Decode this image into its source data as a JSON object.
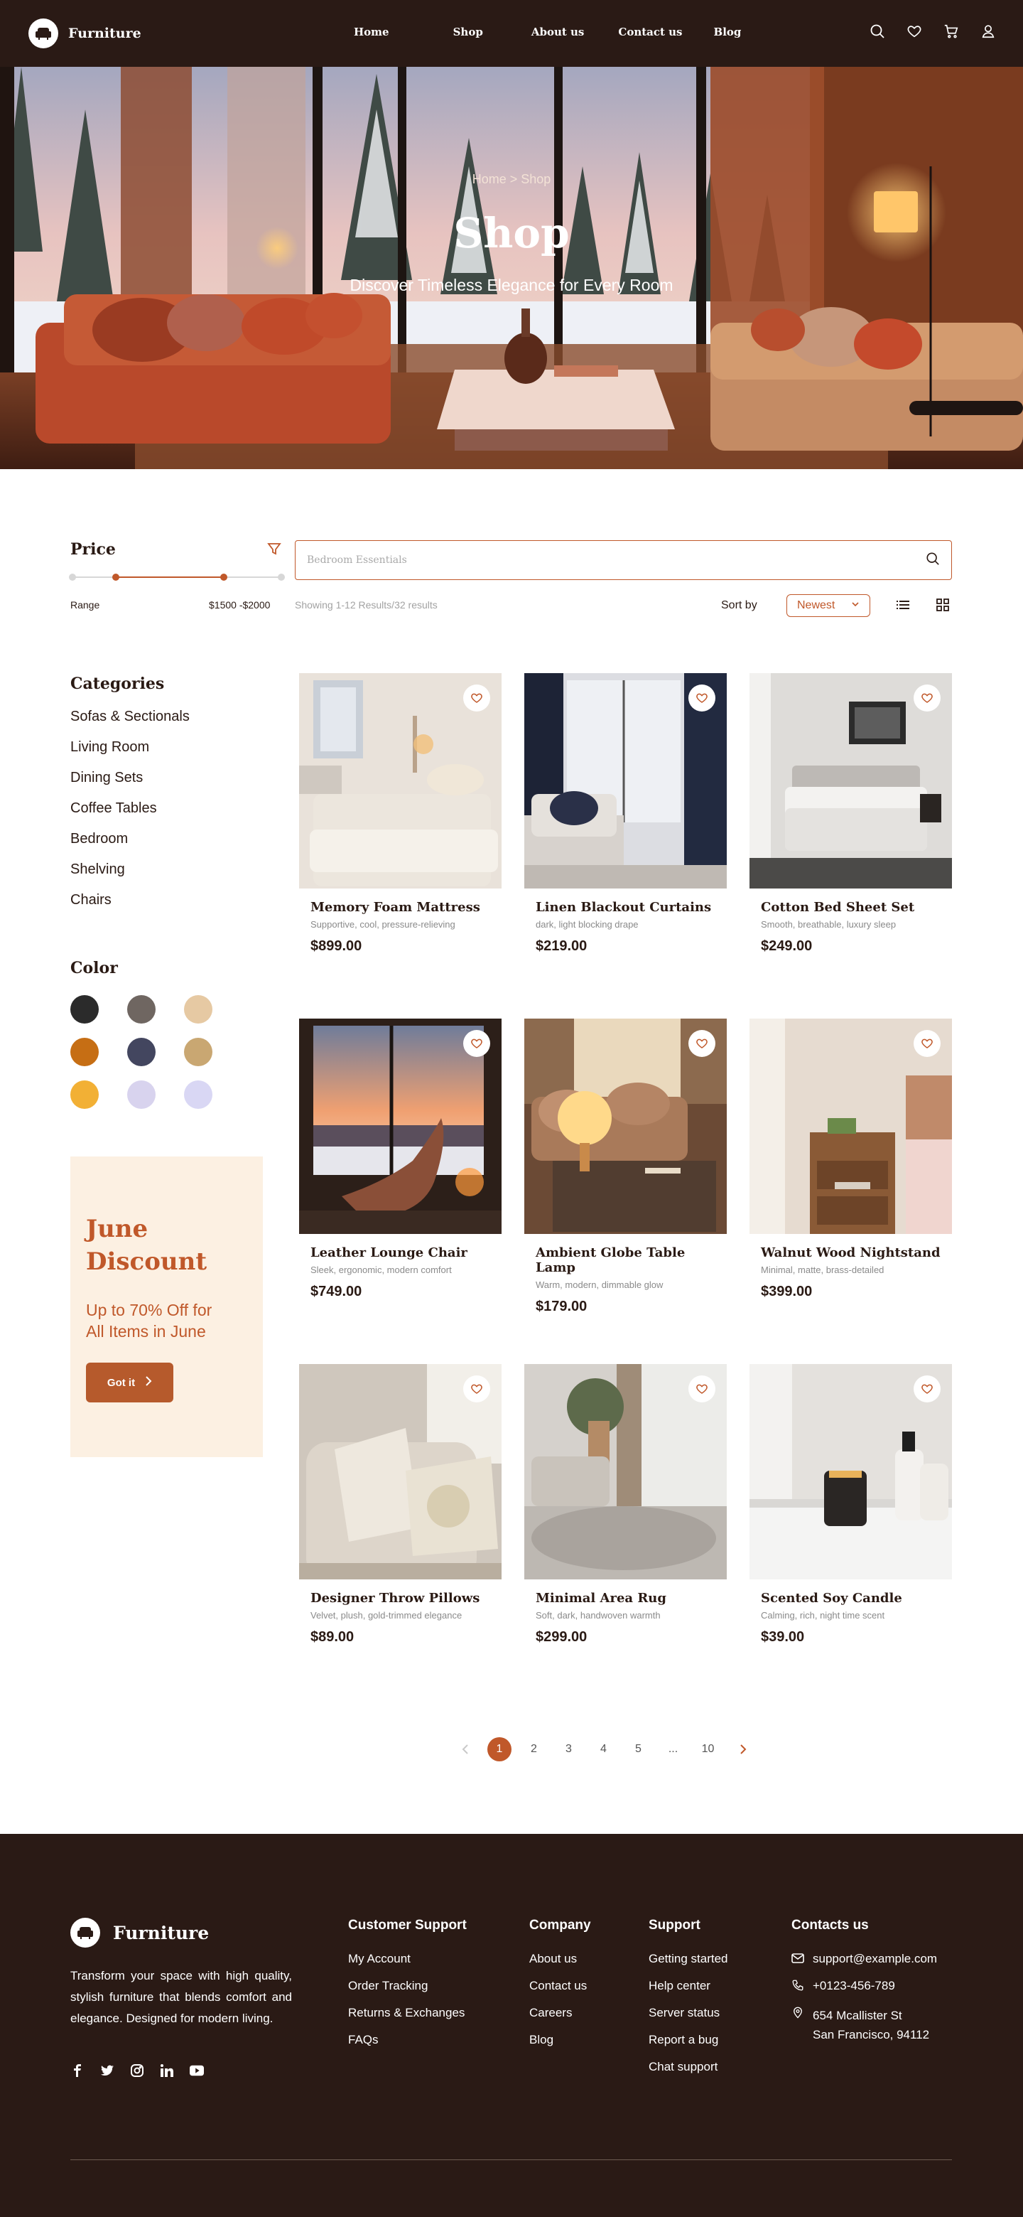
{
  "nav": {
    "brand": "Furniture",
    "links": [
      "Home",
      "Shop",
      "About us",
      "Contact us",
      "Blog"
    ]
  },
  "hero": {
    "breadcrumb": "Home > Shop",
    "title": "Shop",
    "subtitle": "Discover Timeless Elegance for Every Room"
  },
  "filters": {
    "price_title": "Price",
    "range_label": "Range",
    "range_value": "$1500 -$2000",
    "search_placeholder": "Bedroom Essentials",
    "showing": "Showing 1-12 Results/32 results",
    "sort_label": "Sort by",
    "sort_value": "Newest"
  },
  "sidebar": {
    "categories_title": "Categories",
    "categories": [
      "Sofas & Sectionals",
      "Living Room",
      "Dining Sets",
      "Coffee Tables",
      "Bedroom",
      "Shelving",
      "Chairs"
    ],
    "color_title": "Color",
    "colors": [
      "#2b2b2b",
      "#6f6661",
      "#e6c9a3",
      "#c66e14",
      "#43465f",
      "#c9a772",
      "#f2b035",
      "#d8d3ee",
      "#d9d7f4"
    ]
  },
  "promo": {
    "title": "June\nDiscount",
    "subtitle": "Up to 70% Off for\nAll Items in June",
    "button": "Got it"
  },
  "products": [
    {
      "name": "Memory Foam Mattress",
      "desc": "Supportive, cool, pressure-relieving",
      "price": "$899.00"
    },
    {
      "name": "Linen Blackout Curtains",
      "desc": "dark, light blocking drape",
      "price": "$219.00"
    },
    {
      "name": "Cotton Bed Sheet Set",
      "desc": "Smooth, breathable, luxury sleep",
      "price": "$249.00"
    },
    {
      "name": "Leather Lounge Chair",
      "desc": "Sleek, ergonomic, modern comfort",
      "price": "$749.00"
    },
    {
      "name": "Ambient Globe Table Lamp",
      "desc": "Warm, modern, dimmable glow",
      "price": "$179.00"
    },
    {
      "name": "Walnut Wood Nightstand",
      "desc": "Minimal, matte, brass-detailed",
      "price": "$399.00"
    },
    {
      "name": "Designer Throw Pillows",
      "desc": "Velvet, plush, gold-trimmed elegance",
      "price": "$89.00"
    },
    {
      "name": "Minimal Area Rug",
      "desc": "Soft, dark, handwoven warmth",
      "price": "$299.00"
    },
    {
      "name": "Scented Soy Candle",
      "desc": "Calming, rich, night time scent",
      "price": "$39.00"
    }
  ],
  "pagination": {
    "pages": [
      "1",
      "2",
      "3",
      "4",
      "5",
      "...",
      "10"
    ],
    "current": "1"
  },
  "footer": {
    "brand": "Furniture",
    "about": "Transform your space with high quality, stylish furniture that blends comfort and elegance. Designed for modern living.",
    "customer_support": {
      "title": "Customer Support",
      "links": [
        "My Account",
        "Order Tracking",
        "Returns & Exchanges",
        "FAQs"
      ]
    },
    "company": {
      "title": "Company",
      "links": [
        "About us",
        "Contact us",
        "Careers",
        "Blog"
      ]
    },
    "support": {
      "title": "Support",
      "links": [
        "Getting started",
        "Help center",
        "Server status",
        "Report a bug",
        "Chat support"
      ]
    },
    "contacts": {
      "title": "Contacts us",
      "email": "support@example.com",
      "phone": "+0123-456-789",
      "address_line1": "654 Mcallister St",
      "address_line2": "San Francisco, 94112"
    }
  },
  "accent_color": "#c0582a"
}
